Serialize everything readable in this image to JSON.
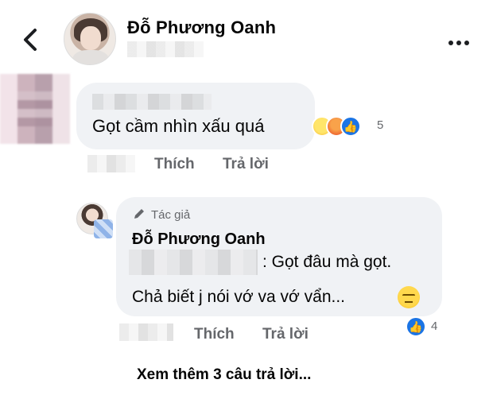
{
  "header": {
    "back_icon": "chevron-left-icon",
    "name": "Đỗ Phương Oanh",
    "more_icon": "more-dots-icon"
  },
  "comment": {
    "text": "Gọt cầm nhìn xấu quá",
    "reactions": {
      "icons": [
        "haha-react-icon",
        "angry-react-icon",
        "like-react-icon"
      ],
      "count": "5"
    },
    "actions": {
      "like": "Thích",
      "reply": "Trả lời"
    }
  },
  "reply": {
    "author_badge": "Tác giả",
    "name": "Đỗ Phương Oanh",
    "line1": ": Gọt đâu mà gọt.",
    "line2": "Chả biết j nói vớ va vớ vẩn...",
    "reactions": {
      "icons": [
        "like-react-icon"
      ],
      "count": "4"
    },
    "actions": {
      "like": "Thích",
      "reply": "Trả lời"
    }
  },
  "footer": {
    "more_replies": "Xem thêm 3 câu trả lời..."
  },
  "colors": {
    "bubble": "#f0f2f5",
    "like_blue": "#1b74e4",
    "muted": "#65676b"
  }
}
